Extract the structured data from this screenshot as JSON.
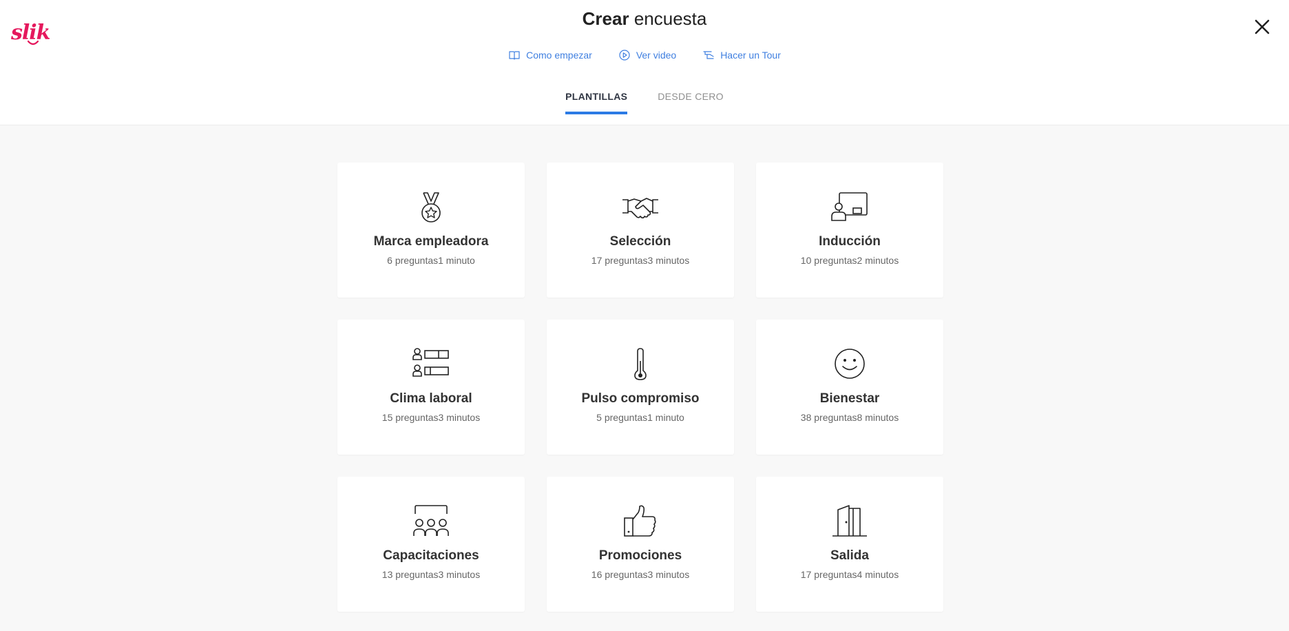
{
  "app": {
    "logo_text": "slik",
    "brand_color": "#e5185d",
    "accent_color": "#2c7be5"
  },
  "header": {
    "title_bold": "Crear",
    "title_rest": "encuesta",
    "help_links": [
      {
        "label": "Como empezar",
        "icon": "book-icon"
      },
      {
        "label": "Ver video",
        "icon": "play-icon"
      },
      {
        "label": "Hacer un Tour",
        "icon": "tour-icon"
      }
    ],
    "close_icon": "close-icon"
  },
  "tabs": [
    {
      "label": "PLANTILLAS",
      "active": true
    },
    {
      "label": "DESDE CERO",
      "active": false
    }
  ],
  "templates": [
    {
      "name": "Marca empleadora",
      "questions": "6 preguntas",
      "duration": "1 minuto",
      "icon": "medal-icon"
    },
    {
      "name": "Selección",
      "questions": "17 preguntas",
      "duration": "3 minutos",
      "icon": "handshake-icon"
    },
    {
      "name": "Inducción",
      "questions": "10 preguntas",
      "duration": "2 minutos",
      "icon": "presenter-icon"
    },
    {
      "name": "Clima laboral",
      "questions": "15 preguntas",
      "duration": "3 minutos",
      "icon": "people-bars-icon"
    },
    {
      "name": "Pulso compromiso",
      "questions": "5 preguntas",
      "duration": "1 minuto",
      "icon": "thermometer-icon"
    },
    {
      "name": "Bienestar",
      "questions": "38 preguntas",
      "duration": "8 minutos",
      "icon": "smiley-icon"
    },
    {
      "name": "Capacitaciones",
      "questions": "13 preguntas",
      "duration": "3 minutos",
      "icon": "classroom-icon"
    },
    {
      "name": "Promociones",
      "questions": "16 preguntas",
      "duration": "3 minutos",
      "icon": "thumbs-up-icon"
    },
    {
      "name": "Salida",
      "questions": "17 preguntas",
      "duration": "4 minutos",
      "icon": "exit-door-icon"
    }
  ]
}
